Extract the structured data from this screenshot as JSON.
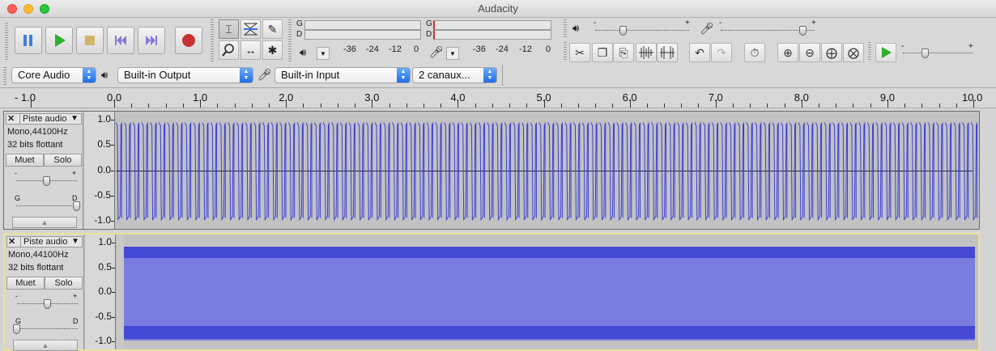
{
  "window": {
    "title": "Audacity"
  },
  "meters": {
    "record_left": "G",
    "record_right": "D",
    "play_left": "G",
    "play_right": "D",
    "scale": [
      "-36",
      "-24",
      "-12",
      "0"
    ]
  },
  "mixer": {
    "minus": "-",
    "plus": "+"
  },
  "device": {
    "host": "Core Audio",
    "output": "Built-in Output",
    "input": "Built-in Input",
    "channels": "2 canaux..."
  },
  "ruler": {
    "labels": [
      "- 1.0",
      "0.0",
      "1.0",
      "2.0",
      "3.0",
      "4.0",
      "5.0",
      "6.0",
      "7.0",
      "8.0",
      "9.0",
      "10.0"
    ]
  },
  "tracks": [
    {
      "name": "Piste audio",
      "format": "Mono,44100Hz",
      "bits": "32 bits flottant",
      "mute": "Muet",
      "solo": "Solo",
      "gain_minus": "-",
      "gain_plus": "+",
      "pan_left": "G",
      "pan_right": "D",
      "gain": 0.5,
      "pan": 1.0,
      "selected": false,
      "scale": [
        "1.0",
        "0.5",
        "0.0",
        "-0.5",
        "-1.0"
      ]
    },
    {
      "name": "Piste audio",
      "format": "Mono,44100Hz",
      "bits": "32 bits flottant",
      "mute": "Muet",
      "solo": "Solo",
      "gain_minus": "-",
      "gain_plus": "+",
      "pan_left": "G",
      "pan_right": "D",
      "gain": 0.5,
      "pan": 0.0,
      "selected": true,
      "scale": [
        "1.0",
        "0.5",
        "0.0",
        "-0.5",
        "-1.0"
      ]
    }
  ],
  "colors": {
    "wave": "#3b3fd6",
    "wave_fill_light": "#7a7ce0",
    "wave_fill_dark": "#4548d2",
    "track_bg": "#c2c2c2",
    "selected_border": "#e9e29a",
    "record": "#c83232",
    "play": "#2bb02b"
  }
}
